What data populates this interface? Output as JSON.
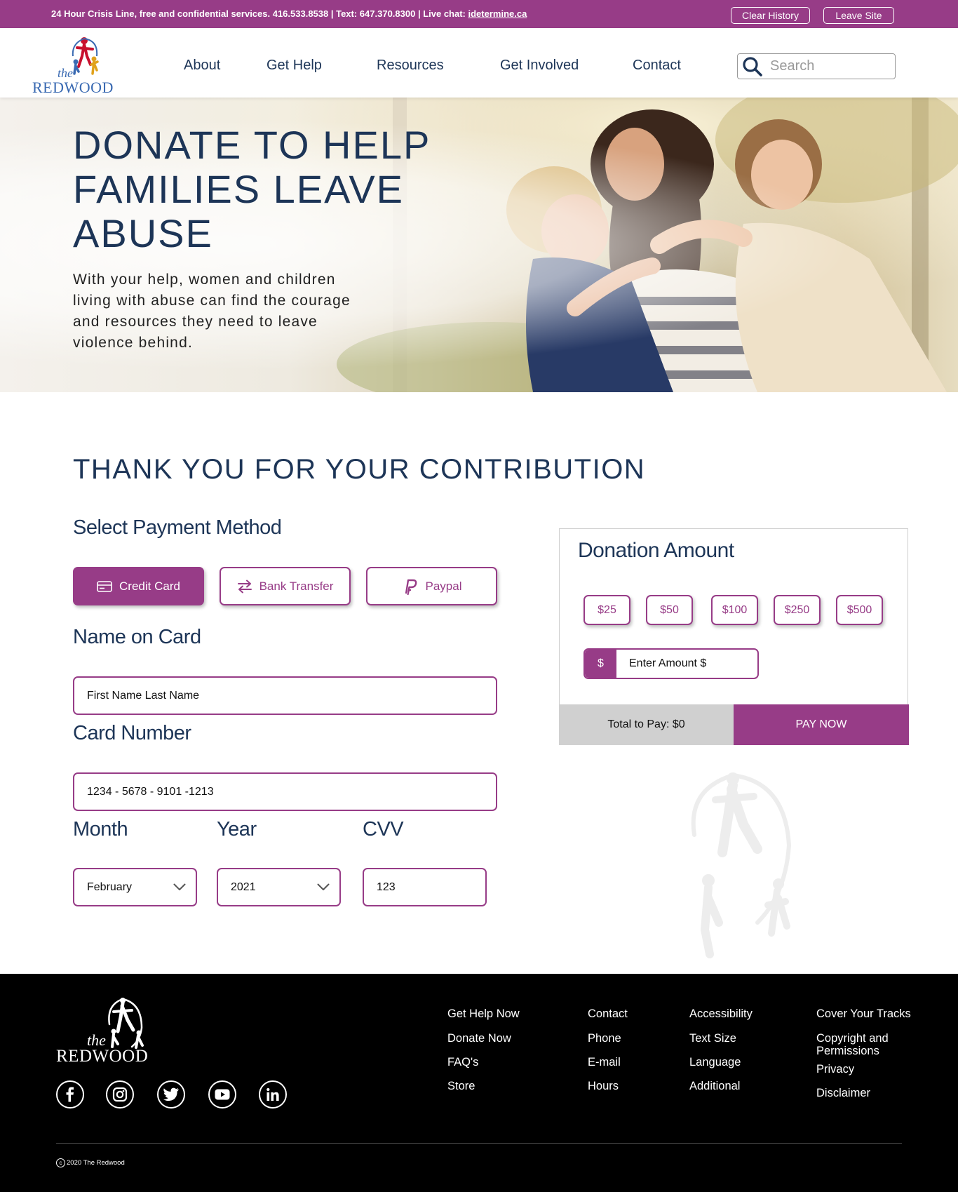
{
  "crisis_bar": {
    "text": "24 Hour Crisis Line, free and confidential services. 416.533.8538 | Text: 647.370.8300 | Live chat: ",
    "chat_link": "idetermine.ca",
    "clear_history": "Clear History",
    "leave_site": "Leave Site"
  },
  "header": {
    "logo_the": "the",
    "logo_word": "REDWOOD",
    "nav": [
      "About",
      "Get Help",
      "Resources",
      "Get Involved",
      "Contact"
    ],
    "search_placeholder": "Search"
  },
  "hero": {
    "title": "DONATE TO HELP FAMILIES LEAVE ABUSE",
    "subtitle": "With your help, women and children living with abuse can find the courage and resources they need to leave violence behind."
  },
  "main": {
    "thanks": "THANK YOU FOR YOUR CONTRIBUTION",
    "payment_method_label": "Select Payment Method",
    "methods": [
      "Credit Card",
      "Bank Transfer",
      "Paypal"
    ],
    "active_method": "Credit Card",
    "name_label": "Name on Card",
    "name_value": "First Name Last Name",
    "card_label": "Card Number",
    "card_value": "1234 - 5678 - 9101 -1213",
    "month_label": "Month",
    "month_value": "February",
    "year_label": "Year",
    "year_value": "2021",
    "cvv_label": "CVV",
    "cvv_value": "123"
  },
  "donation": {
    "title": "Donation Amount",
    "amounts": [
      "$25",
      "$50",
      "$100",
      "$250",
      "$500"
    ],
    "custom_prefix": "$",
    "custom_placeholder": "Enter Amount $",
    "total": "Total to Pay: $0",
    "pay_now": "PAY NOW"
  },
  "footer": {
    "logo_the": "the",
    "logo_word": "REDWOOD",
    "col1": [
      "Get Help Now",
      "Donate Now",
      "FAQ's",
      "Store"
    ],
    "col2": [
      "Contact",
      "Phone",
      "E-mail",
      "Hours"
    ],
    "col3": [
      "Accessibility",
      "Text Size",
      "Language",
      "Additional"
    ],
    "col4": [
      "Cover Your Tracks",
      "Copyright and Permissions",
      "Privacy",
      "Disclaimer"
    ],
    "social": [
      "facebook-icon",
      "instagram-icon",
      "twitter-icon",
      "youtube-icon",
      "linkedin-icon"
    ],
    "copyright_symbol": "c",
    "copyright": "2020 The Redwood"
  },
  "colors": {
    "brand_purple": "#973c87",
    "navy": "#1d3557",
    "footer_bg": "#000000"
  }
}
